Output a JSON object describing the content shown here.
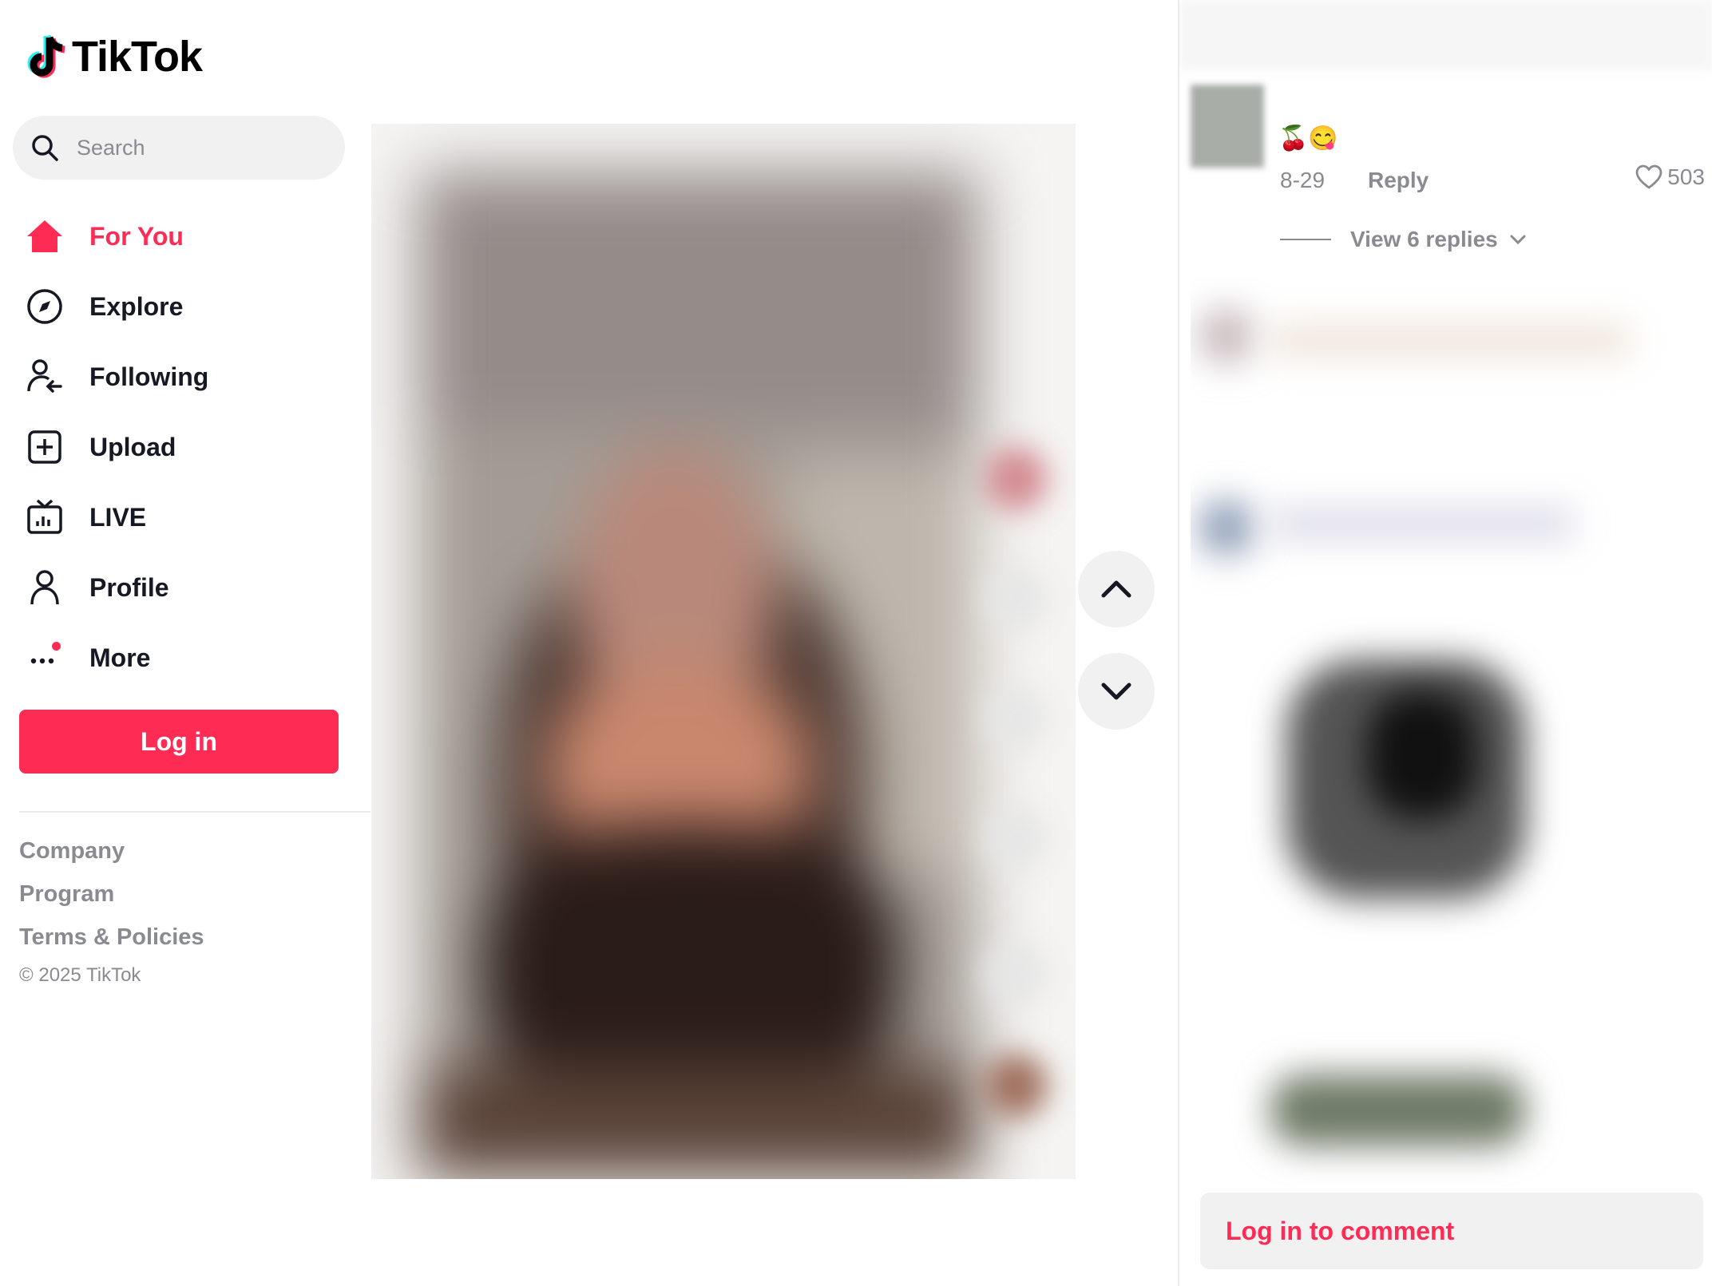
{
  "brand": {
    "name": "TikTok",
    "accent": "#fe2c55"
  },
  "search": {
    "placeholder": "Search"
  },
  "nav": [
    {
      "label": "For You",
      "icon": "home-icon",
      "active": true
    },
    {
      "label": "Explore",
      "icon": "compass-icon"
    },
    {
      "label": "Following",
      "icon": "following-icon"
    },
    {
      "label": "Upload",
      "icon": "upload-icon"
    },
    {
      "label": "LIVE",
      "icon": "live-icon"
    },
    {
      "label": "Profile",
      "icon": "profile-icon"
    },
    {
      "label": "More",
      "icon": "more-icon"
    }
  ],
  "login_button": "Log in",
  "footer": {
    "links": [
      "Company",
      "Program",
      "Terms & Policies"
    ],
    "copyright": "© 2025 TikTok"
  },
  "comment": {
    "emoji": "🍒😋",
    "date": "8-29",
    "reply_label": "Reply",
    "likes": "503",
    "view_replies": "View 6 replies"
  },
  "comment_box": {
    "label": "Log in to comment"
  }
}
